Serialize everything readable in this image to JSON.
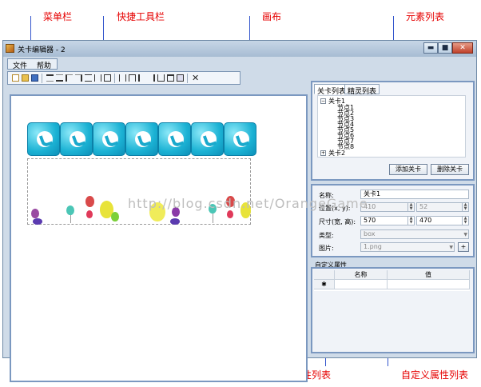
{
  "callouts": {
    "menubar": "菜单栏",
    "toolbar": "快捷工具栏",
    "canvas": "画布",
    "element_list": "元素列表",
    "property_list": "属性列表",
    "custom_property_list": "自定义属性列表"
  },
  "window": {
    "title": "关卡编辑器 - 2",
    "minimize": "▬",
    "maximize": "■",
    "close": "✕"
  },
  "menu": {
    "file": "文件",
    "help": "帮助"
  },
  "toolbar": {
    "icons": [
      "new-icon",
      "open-icon",
      "save-icon",
      "align-top-icon",
      "align-middle-icon",
      "align-left-icon",
      "align-right-icon",
      "center-horizontal-icon",
      "center-vertical-icon",
      "same-size-icon",
      "distribute-vertical-icon",
      "distribute-horizontal-icon",
      "align-column-left-icon",
      "align-column-right-icon",
      "spread-icon",
      "grid-icon",
      "fit-icon",
      "delete-icon"
    ],
    "delete_glyph": "✕"
  },
  "watermark": "http://blog.csdn.net/OrangeGame",
  "element_panel": {
    "tabs": [
      "关卡列表",
      "精灵列表"
    ],
    "tree": {
      "level1": "关卡1",
      "nodes": [
        "节点1",
        "节点2",
        "节点3",
        "节点4",
        "节点5",
        "节点6",
        "节点7",
        "节点8"
      ],
      "level2": "关卡2"
    },
    "add_button": "添加关卡",
    "delete_button": "删除关卡"
  },
  "property_panel": {
    "name_label": "名称:",
    "name_value": "关卡1",
    "position_label": "位置(x, y):",
    "position_x": "410",
    "position_y": "52",
    "size_label": "尺寸(宽, 高):",
    "size_w": "570",
    "size_h": "470",
    "type_label": "类型:",
    "type_value": "box",
    "image_label": "图片:",
    "image_value": "1.png",
    "image_button": "+"
  },
  "custom_panel": {
    "title": "自定义属性",
    "col_name": "名称",
    "col_value": "值",
    "new_row_marker": "✱"
  }
}
